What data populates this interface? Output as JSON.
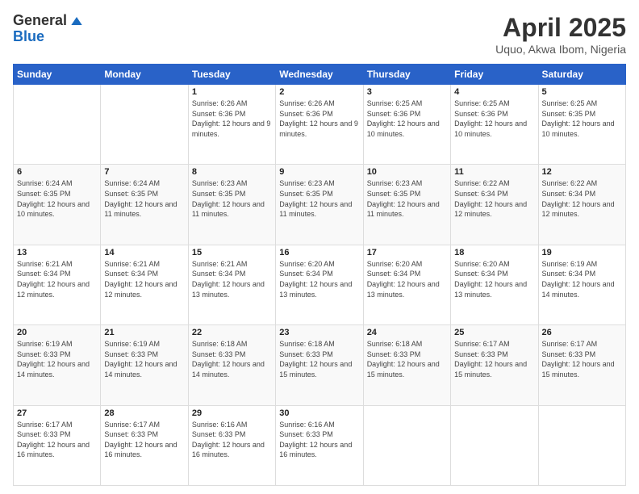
{
  "logo": {
    "general": "General",
    "blue": "Blue"
  },
  "header": {
    "month": "April 2025",
    "location": "Uquo, Akwa Ibom, Nigeria"
  },
  "weekdays": [
    "Sunday",
    "Monday",
    "Tuesday",
    "Wednesday",
    "Thursday",
    "Friday",
    "Saturday"
  ],
  "weeks": [
    [
      {
        "day": "",
        "info": ""
      },
      {
        "day": "",
        "info": ""
      },
      {
        "day": "1",
        "info": "Sunrise: 6:26 AM\nSunset: 6:36 PM\nDaylight: 12 hours and 9 minutes."
      },
      {
        "day": "2",
        "info": "Sunrise: 6:26 AM\nSunset: 6:36 PM\nDaylight: 12 hours and 9 minutes."
      },
      {
        "day": "3",
        "info": "Sunrise: 6:25 AM\nSunset: 6:36 PM\nDaylight: 12 hours and 10 minutes."
      },
      {
        "day": "4",
        "info": "Sunrise: 6:25 AM\nSunset: 6:36 PM\nDaylight: 12 hours and 10 minutes."
      },
      {
        "day": "5",
        "info": "Sunrise: 6:25 AM\nSunset: 6:35 PM\nDaylight: 12 hours and 10 minutes."
      }
    ],
    [
      {
        "day": "6",
        "info": "Sunrise: 6:24 AM\nSunset: 6:35 PM\nDaylight: 12 hours and 10 minutes."
      },
      {
        "day": "7",
        "info": "Sunrise: 6:24 AM\nSunset: 6:35 PM\nDaylight: 12 hours and 11 minutes."
      },
      {
        "day": "8",
        "info": "Sunrise: 6:23 AM\nSunset: 6:35 PM\nDaylight: 12 hours and 11 minutes."
      },
      {
        "day": "9",
        "info": "Sunrise: 6:23 AM\nSunset: 6:35 PM\nDaylight: 12 hours and 11 minutes."
      },
      {
        "day": "10",
        "info": "Sunrise: 6:23 AM\nSunset: 6:35 PM\nDaylight: 12 hours and 11 minutes."
      },
      {
        "day": "11",
        "info": "Sunrise: 6:22 AM\nSunset: 6:34 PM\nDaylight: 12 hours and 12 minutes."
      },
      {
        "day": "12",
        "info": "Sunrise: 6:22 AM\nSunset: 6:34 PM\nDaylight: 12 hours and 12 minutes."
      }
    ],
    [
      {
        "day": "13",
        "info": "Sunrise: 6:21 AM\nSunset: 6:34 PM\nDaylight: 12 hours and 12 minutes."
      },
      {
        "day": "14",
        "info": "Sunrise: 6:21 AM\nSunset: 6:34 PM\nDaylight: 12 hours and 12 minutes."
      },
      {
        "day": "15",
        "info": "Sunrise: 6:21 AM\nSunset: 6:34 PM\nDaylight: 12 hours and 13 minutes."
      },
      {
        "day": "16",
        "info": "Sunrise: 6:20 AM\nSunset: 6:34 PM\nDaylight: 12 hours and 13 minutes."
      },
      {
        "day": "17",
        "info": "Sunrise: 6:20 AM\nSunset: 6:34 PM\nDaylight: 12 hours and 13 minutes."
      },
      {
        "day": "18",
        "info": "Sunrise: 6:20 AM\nSunset: 6:34 PM\nDaylight: 12 hours and 13 minutes."
      },
      {
        "day": "19",
        "info": "Sunrise: 6:19 AM\nSunset: 6:34 PM\nDaylight: 12 hours and 14 minutes."
      }
    ],
    [
      {
        "day": "20",
        "info": "Sunrise: 6:19 AM\nSunset: 6:33 PM\nDaylight: 12 hours and 14 minutes."
      },
      {
        "day": "21",
        "info": "Sunrise: 6:19 AM\nSunset: 6:33 PM\nDaylight: 12 hours and 14 minutes."
      },
      {
        "day": "22",
        "info": "Sunrise: 6:18 AM\nSunset: 6:33 PM\nDaylight: 12 hours and 14 minutes."
      },
      {
        "day": "23",
        "info": "Sunrise: 6:18 AM\nSunset: 6:33 PM\nDaylight: 12 hours and 15 minutes."
      },
      {
        "day": "24",
        "info": "Sunrise: 6:18 AM\nSunset: 6:33 PM\nDaylight: 12 hours and 15 minutes."
      },
      {
        "day": "25",
        "info": "Sunrise: 6:17 AM\nSunset: 6:33 PM\nDaylight: 12 hours and 15 minutes."
      },
      {
        "day": "26",
        "info": "Sunrise: 6:17 AM\nSunset: 6:33 PM\nDaylight: 12 hours and 15 minutes."
      }
    ],
    [
      {
        "day": "27",
        "info": "Sunrise: 6:17 AM\nSunset: 6:33 PM\nDaylight: 12 hours and 16 minutes."
      },
      {
        "day": "28",
        "info": "Sunrise: 6:17 AM\nSunset: 6:33 PM\nDaylight: 12 hours and 16 minutes."
      },
      {
        "day": "29",
        "info": "Sunrise: 6:16 AM\nSunset: 6:33 PM\nDaylight: 12 hours and 16 minutes."
      },
      {
        "day": "30",
        "info": "Sunrise: 6:16 AM\nSunset: 6:33 PM\nDaylight: 12 hours and 16 minutes."
      },
      {
        "day": "",
        "info": ""
      },
      {
        "day": "",
        "info": ""
      },
      {
        "day": "",
        "info": ""
      }
    ]
  ]
}
